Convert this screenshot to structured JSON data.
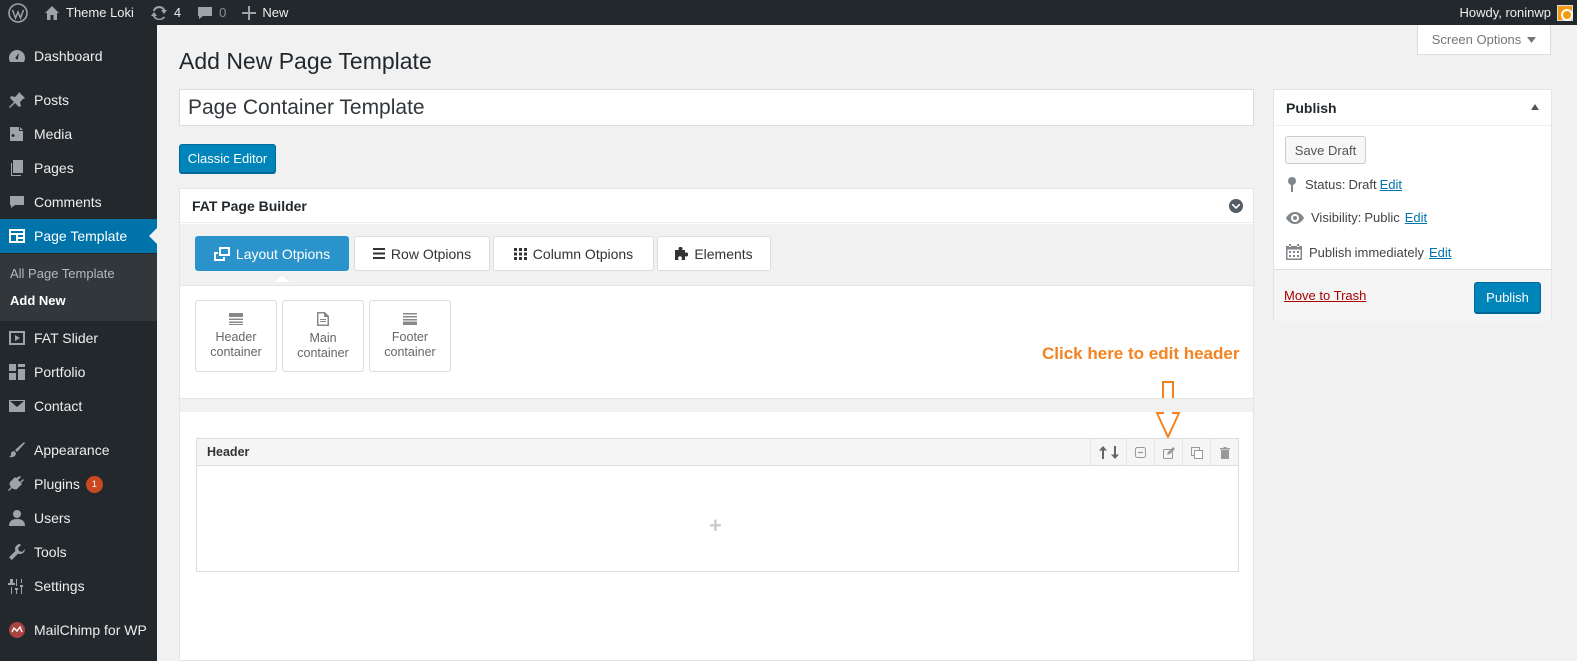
{
  "adminbar": {
    "site_name": "Theme Loki",
    "updates_count": "4",
    "comments_count": "0",
    "new_label": "New",
    "howdy": "Howdy, roninwp"
  },
  "sidebar": {
    "items": [
      {
        "label": "Dashboard",
        "icon": "dashboard-icon"
      },
      {
        "label": "Posts",
        "icon": "pin-icon"
      },
      {
        "label": "Media",
        "icon": "media-icon"
      },
      {
        "label": "Pages",
        "icon": "pages-icon"
      },
      {
        "label": "Comments",
        "icon": "comment-icon"
      },
      {
        "label": "Page Template",
        "icon": "template-icon"
      },
      {
        "label": "FAT Slider",
        "icon": "slider-icon"
      },
      {
        "label": "Portfolio",
        "icon": "portfolio-icon"
      },
      {
        "label": "Contact",
        "icon": "mail-icon"
      },
      {
        "label": "Appearance",
        "icon": "brush-icon"
      },
      {
        "label": "Plugins",
        "icon": "plugin-icon",
        "badge": "1"
      },
      {
        "label": "Users",
        "icon": "user-icon"
      },
      {
        "label": "Tools",
        "icon": "wrench-icon"
      },
      {
        "label": "Settings",
        "icon": "settings-icon"
      },
      {
        "label": "MailChimp for WP",
        "icon": "mailchimp-icon"
      }
    ],
    "submenu": [
      "All Page Template",
      "Add New"
    ]
  },
  "screen_options": "Screen Options",
  "page_title": "Add New Page Template",
  "title_value": "Page Container Template",
  "classic_editor": "Classic Editor",
  "builder": {
    "title": "FAT Page Builder",
    "tabs": [
      "Layout Otpions",
      "Row Otpions",
      "Column Otpions",
      "Elements"
    ],
    "containers": [
      {
        "line1": "Header",
        "line2": "container"
      },
      {
        "line1": "Main",
        "line2": "container"
      },
      {
        "line1": "Footer",
        "line2": "container"
      }
    ],
    "annotation": "Click here to edit header",
    "row_title": "Header",
    "add_symbol": "+"
  },
  "publish": {
    "title": "Publish",
    "save_draft": "Save Draft",
    "status_label": "Status:",
    "status_value": "Draft",
    "visibility_label": "Visibility:",
    "visibility_value": "Public",
    "publish_label": "Publish",
    "publish_value": "immediately",
    "edit": "Edit",
    "trash": "Move to Trash",
    "publish_button": "Publish"
  },
  "colors": {
    "admin_dark": "#23282d",
    "accent": "#0073aa",
    "button_blue": "#0085ba",
    "tab_active": "#2b93cb",
    "annotation": "#f58220",
    "trash_red": "#a00"
  }
}
